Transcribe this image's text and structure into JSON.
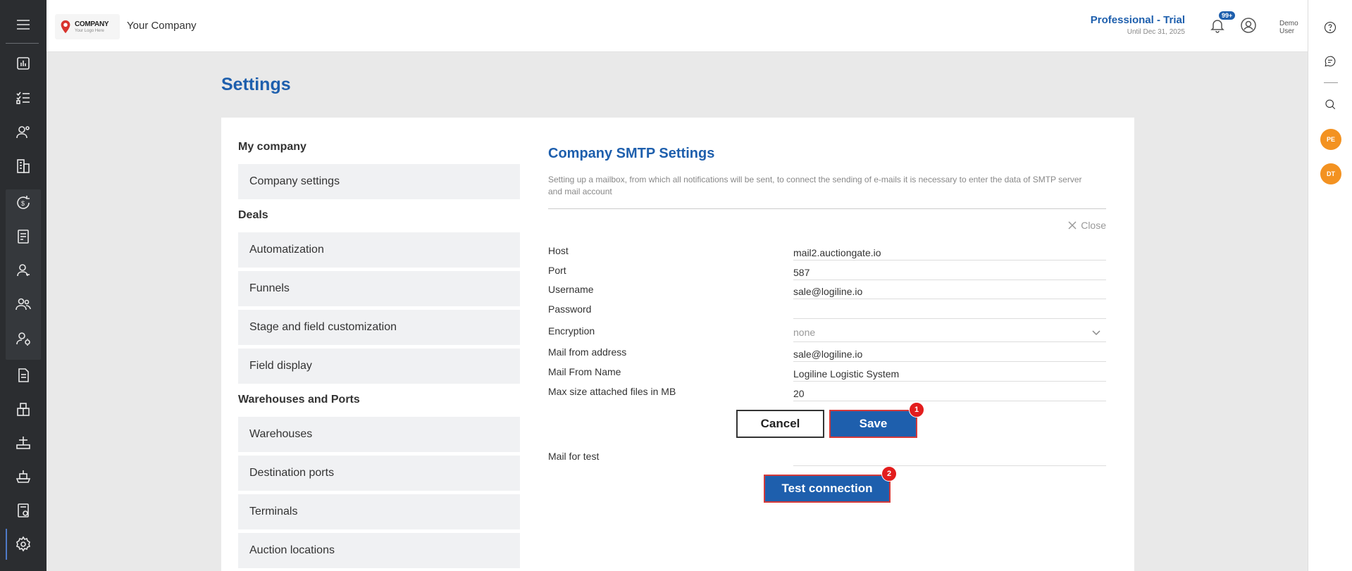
{
  "header": {
    "logo_main": "COMPANY",
    "logo_sub": "Your Logo Here",
    "company_name": "Your Company",
    "plan_name": "Professional - Trial",
    "plan_until": "Until Dec 31, 2025",
    "notifications_badge": "99+",
    "user_first": "Demo",
    "user_last": "User"
  },
  "sidebar": {
    "icons": [
      "menu-icon",
      "dashboard-icon",
      "tasks-icon",
      "contacts-icon",
      "company-icon",
      "finance-icon",
      "ledger-icon",
      "user-icon",
      "team-icon",
      "user-settings-icon",
      "document-icon",
      "warehouse-icon",
      "port-icon",
      "ship-icon",
      "calculator-icon",
      "settings-icon"
    ]
  },
  "right_rail": {
    "avatars": [
      "PE",
      "DT"
    ]
  },
  "page": {
    "title": "Settings"
  },
  "settings_nav": {
    "sections": [
      {
        "heading": "My company",
        "items": [
          "Company settings"
        ]
      },
      {
        "heading": "Deals",
        "items": [
          "Automatization",
          "Funnels",
          "Stage and field customization",
          "Field display"
        ]
      },
      {
        "heading": "Warehouses and Ports",
        "items": [
          "Warehouses",
          "Destination ports",
          "Terminals",
          "Auction locations"
        ]
      }
    ]
  },
  "smtp": {
    "title": "Company SMTP Settings",
    "description": "Setting up a mailbox, from which all notifications will be sent, to connect the sending of e-mails it is necessary to enter the data of SMTP server and mail account",
    "close_label": "Close",
    "fields": {
      "host": {
        "label": "Host",
        "value": "mail2.auctiongate.io"
      },
      "port": {
        "label": "Port",
        "value": "587"
      },
      "username": {
        "label": "Username",
        "value": "sale@logiline.io"
      },
      "password": {
        "label": "Password",
        "value": ""
      },
      "encryption": {
        "label": "Encryption",
        "value": "none"
      },
      "mail_from_address": {
        "label": "Mail from address",
        "value": "sale@logiline.io"
      },
      "mail_from_name": {
        "label": "Mail From Name",
        "value": "Logiline Logistic System"
      },
      "max_size": {
        "label": "Max size attached files in MB",
        "value": "20"
      },
      "mail_for_test": {
        "label": "Mail for test",
        "value": ""
      }
    },
    "cancel_label": "Cancel",
    "save_label": "Save",
    "test_label": "Test connection",
    "save_step": "1",
    "test_step": "2"
  },
  "colors": {
    "accent": "#1e5fad",
    "sidebar_bg": "#2b2d30",
    "badge_red": "#e31d1d",
    "avatar_orange": "#f39221"
  }
}
